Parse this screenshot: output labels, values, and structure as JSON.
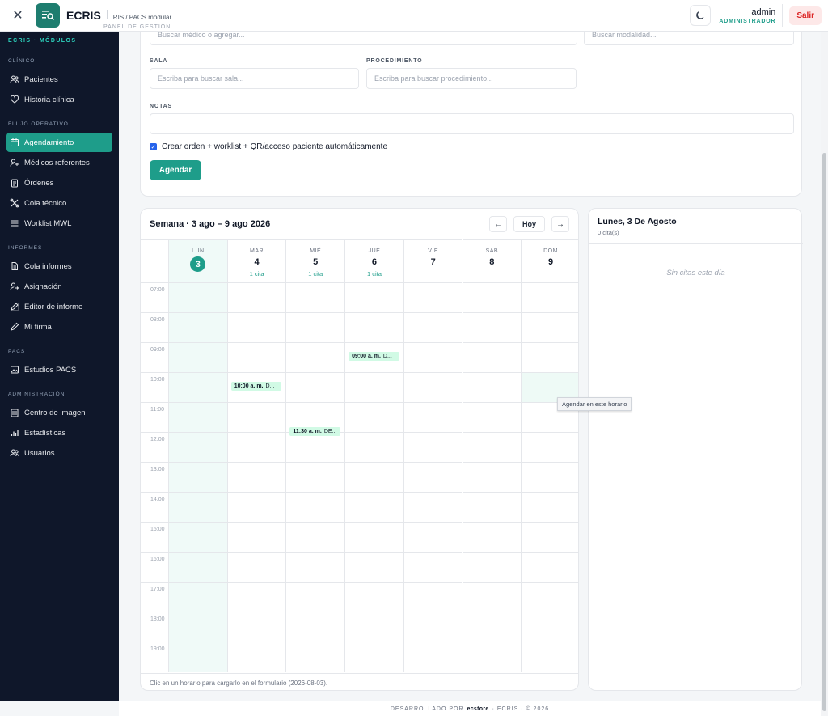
{
  "topbar": {
    "close_glyph": "✕",
    "brand_name": "ECRIS",
    "brand_subtitle": "RIS / PACS modular",
    "brand_tagline": "PANEL DE GESTIÓN",
    "user_name": "admin",
    "user_role": "ADMINISTRADOR",
    "logout_label": "Salir"
  },
  "sidebar": {
    "title": "ECRIS · MÓDULOS",
    "sections": [
      {
        "label": "CLÍNICO",
        "items": [
          {
            "label": "Pacientes",
            "icon": "users-icon"
          },
          {
            "label": "Historia clínica",
            "icon": "heart-icon"
          }
        ]
      },
      {
        "label": "FLUJO OPERATIVO",
        "items": [
          {
            "label": "Agendamiento",
            "icon": "calendar-icon",
            "active": true
          },
          {
            "label": "Médicos referentes",
            "icon": "user-plus-icon"
          },
          {
            "label": "Órdenes",
            "icon": "clipboard-icon"
          },
          {
            "label": "Cola técnico",
            "icon": "tools-icon"
          },
          {
            "label": "Worklist MWL",
            "icon": "list-icon"
          }
        ]
      },
      {
        "label": "INFORMES",
        "items": [
          {
            "label": "Cola informes",
            "icon": "document-icon"
          },
          {
            "label": "Asignación",
            "icon": "user-assign-icon"
          },
          {
            "label": "Editor de informe",
            "icon": "edit-icon"
          },
          {
            "label": "Mi firma",
            "icon": "pen-icon"
          }
        ]
      },
      {
        "label": "PACS",
        "items": [
          {
            "label": "Estudios PACS",
            "icon": "image-icon"
          }
        ]
      },
      {
        "label": "ADMINISTRACIÓN",
        "items": [
          {
            "label": "Centro de imagen",
            "icon": "building-icon"
          },
          {
            "label": "Estadísticas",
            "icon": "chart-icon"
          },
          {
            "label": "Usuarios",
            "icon": "users-icon"
          }
        ]
      }
    ]
  },
  "form": {
    "medico_placeholder": "Buscar médico o agregar...",
    "modalidad_placeholder": "Buscar modalidad...",
    "sala_label": "SALA",
    "sala_placeholder": "Escriba para buscar sala...",
    "procedimiento_label": "PROCEDIMIENTO",
    "procedimiento_placeholder": "Escriba para buscar procedimiento...",
    "notas_label": "NOTAS",
    "notas_value": "",
    "auto_checkbox_label": "Crear orden + worklist + QR/acceso paciente automáticamente",
    "auto_checkbox_checked": true,
    "submit_label": "Agendar"
  },
  "calendar": {
    "title": "Semana · 3 ago – 9 ago 2026",
    "prev_glyph": "←",
    "today_label": "Hoy",
    "next_glyph": "→",
    "days": [
      {
        "name": "LUN",
        "num": "3",
        "count": "",
        "today": true
      },
      {
        "name": "MAR",
        "num": "4",
        "count": "1 cita",
        "today": false
      },
      {
        "name": "MIÉ",
        "num": "5",
        "count": "1 cita",
        "today": false
      },
      {
        "name": "JUE",
        "num": "6",
        "count": "1 cita",
        "today": false
      },
      {
        "name": "VIE",
        "num": "7",
        "count": "",
        "today": false
      },
      {
        "name": "SÁB",
        "num": "8",
        "count": "",
        "today": false
      },
      {
        "name": "DOM",
        "num": "9",
        "count": "",
        "today": false
      }
    ],
    "hours": [
      "07:00",
      "08:00",
      "09:00",
      "10:00",
      "11:00",
      "12:00",
      "13:00",
      "14:00",
      "15:00",
      "16:00",
      "17:00",
      "18:00",
      "19:00"
    ],
    "events": [
      {
        "day": 3,
        "start_hour": 9.0,
        "time": "09:00 a. m.",
        "text": "D..."
      },
      {
        "day": 1,
        "start_hour": 10.0,
        "time": "10:00 a. m.",
        "text": "D..."
      },
      {
        "day": 2,
        "start_hour": 11.5,
        "time": "11:30 a. m.",
        "text": "DE..."
      }
    ],
    "hover_cell": {
      "day": 6,
      "hour": "10:00"
    },
    "tooltip": "Agendar en este horario",
    "footer_text": "Clic en un horario para cargarlo en el formulario (2026-08-03)."
  },
  "day_panel": {
    "title": "Lunes, 3 De Agosto",
    "count": "0 cita(s)",
    "empty_text": "Sin citas este día"
  },
  "footer": {
    "prefix": "DESARROLLADO POR",
    "brand": "ecstore",
    "suffix": "· ECRIS · © 2026"
  },
  "colors": {
    "accent": "#1e9d8a",
    "sidebar_bg": "#0f172a",
    "event_bg": "#d1fae5",
    "danger": "#dc2626"
  }
}
